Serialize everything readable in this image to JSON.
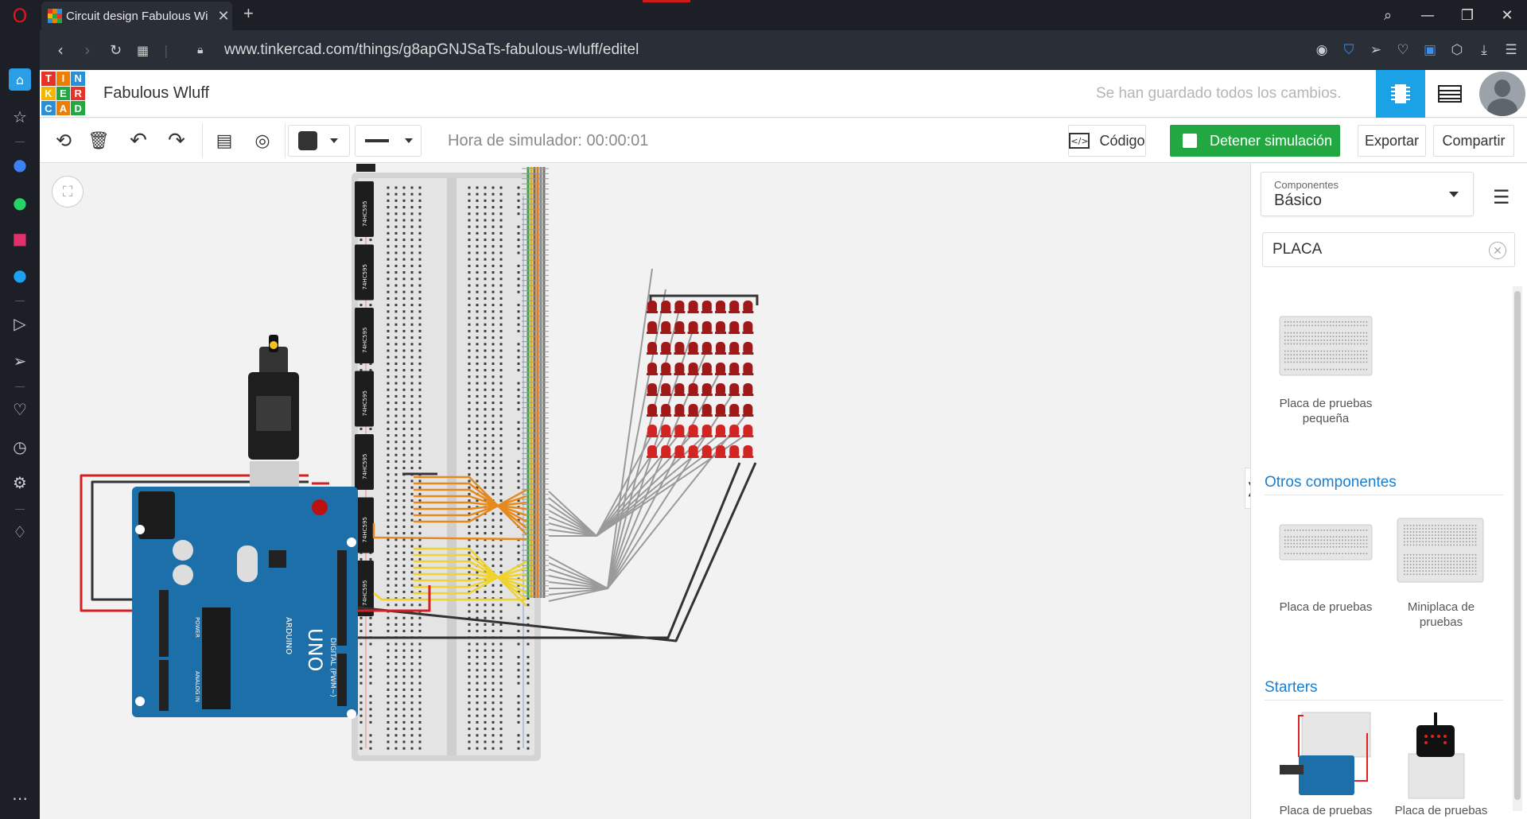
{
  "browser": {
    "tab_title": "Circuit design Fabulous Wi",
    "url": "www.tinkercad.com/things/g8apGNJSaTs-fabulous-wluff/editel"
  },
  "header": {
    "logo_letters": [
      "T",
      "I",
      "N",
      "K",
      "E",
      "R",
      "C",
      "A",
      "D"
    ],
    "logo_colors": [
      "#e6332a",
      "#ef7d00",
      "#2b8fd6",
      "#f3b500",
      "#21a840",
      "#e6332a",
      "#2b8fd6",
      "#ef7d00",
      "#21a840"
    ],
    "project_name": "Fabulous Wluff",
    "save_status": "Se han guardado todos los cambios."
  },
  "toolbar": {
    "sim_time": "Hora de simulador: 00:00:01",
    "code_label": "Código",
    "stop_label": "Detener simulación",
    "export_label": "Exportar",
    "share_label": "Compartir"
  },
  "panel": {
    "components_label": "Componentes",
    "components_value": "Básico",
    "search_value": "PLACA",
    "item_small_breadboard": "Placa de pruebas pequeña",
    "section_other": "Otros componentes",
    "item_breadboard": "Placa de pruebas",
    "item_mini_breadboard": "Miniplaca de pruebas",
    "section_starters": "Starters",
    "item_starter1": "Placa de pruebas",
    "item_starter2": "Placa de pruebas"
  },
  "circuit": {
    "chip_label": "74HC595",
    "board_name": "UNO",
    "board_brand": "ARDUINO",
    "board_pin_header": "DIGITAL (PWM~)",
    "board_power_header": "POWER",
    "board_analog_header": "ANALOG IN",
    "chip_count": 7,
    "led_rows": 8,
    "led_cols": 8,
    "colors": {
      "accent": "#1aa1e6",
      "green": "#21a840",
      "board": "#1c6fa8",
      "led": "#a01818"
    }
  }
}
